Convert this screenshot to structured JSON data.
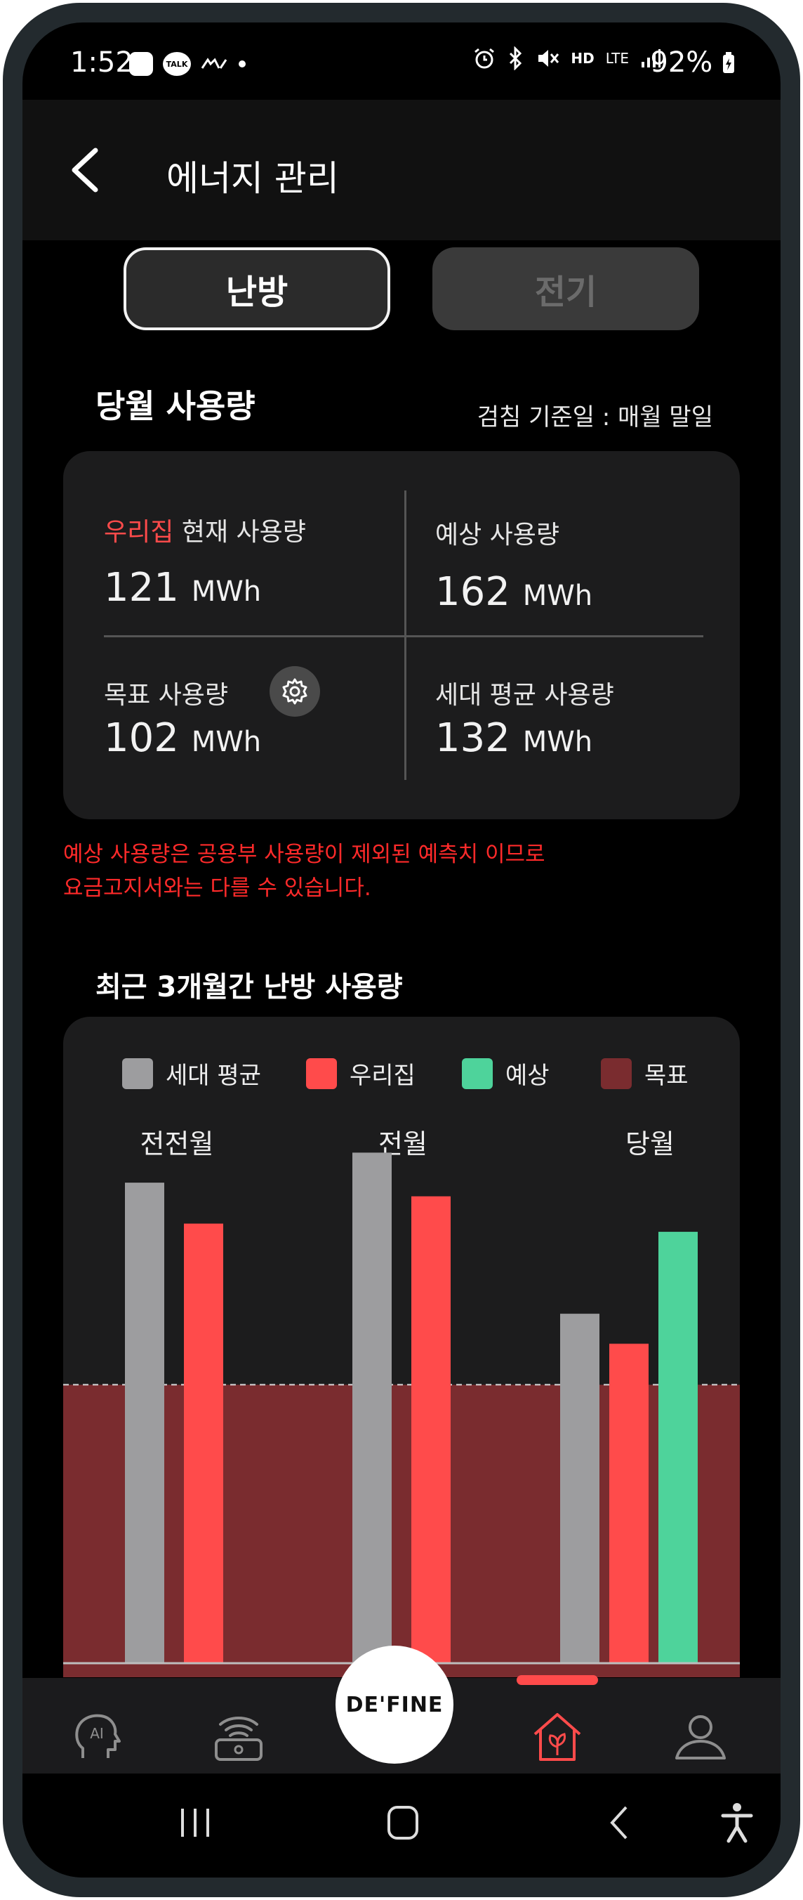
{
  "status": {
    "time": "1:52",
    "talk_badge": "TALK",
    "battery": "92%",
    "hd": "HD",
    "lte": "LTE"
  },
  "header": {
    "title": "에너지 관리"
  },
  "tabs": [
    {
      "label": "난방",
      "active": true
    },
    {
      "label": "전기",
      "active": false
    }
  ],
  "monthly": {
    "title": "당월 사용량",
    "meter_reading": "검침 기준일 : 매월 말일",
    "current": {
      "label_accent": "우리집",
      "label_rest": " 현재 사용량",
      "value": "121",
      "unit": "MWh"
    },
    "expected": {
      "label": "예상 사용량",
      "value": "162",
      "unit": "MWh"
    },
    "target": {
      "label": "목표 사용량",
      "value": "102",
      "unit": "MWh"
    },
    "average": {
      "label": "세대 평균 사용량",
      "value": "132",
      "unit": "MWh"
    }
  },
  "notice": {
    "line1": "예상 사용량은 공용부 사용량이 제외된 예측치 이므로",
    "line2": "요금고지서와는 다를 수 있습니다."
  },
  "recent": {
    "title": "최근 3개월간 난방 사용량",
    "legend": [
      {
        "name": "세대 평균",
        "color": "#9d9d9f"
      },
      {
        "name": "우리집",
        "color": "#ff4b4b"
      },
      {
        "name": "예상",
        "color": "#4ed39b"
      },
      {
        "name": "목표",
        "color": "#7a2c2f"
      }
    ]
  },
  "chart_data": {
    "type": "bar",
    "categories": [
      "전전월",
      "전월",
      "당월"
    ],
    "ylim": [
      0,
      175
    ],
    "target": 102,
    "series": [
      {
        "name": "세대 평균",
        "color": "#9d9d9f",
        "values": [
          176,
          187,
          128
        ]
      },
      {
        "name": "우리집",
        "color": "#ff4b4b",
        "values": [
          161,
          171,
          117
        ]
      },
      {
        "name": "예상",
        "color": "#4ed39b",
        "values": [
          null,
          null,
          158
        ]
      }
    ]
  },
  "bottom_nav": {
    "center_label": "DE'FINE",
    "ai_label": "AI",
    "items": [
      {
        "icon": "ai-head-icon"
      },
      {
        "icon": "router-icon"
      },
      {
        "icon": "house-leaf-icon",
        "active": true
      },
      {
        "icon": "person-icon"
      }
    ]
  },
  "colors": {
    "accent": "#ff4b4b",
    "card": "#1c1c1d",
    "background": "#000000"
  }
}
